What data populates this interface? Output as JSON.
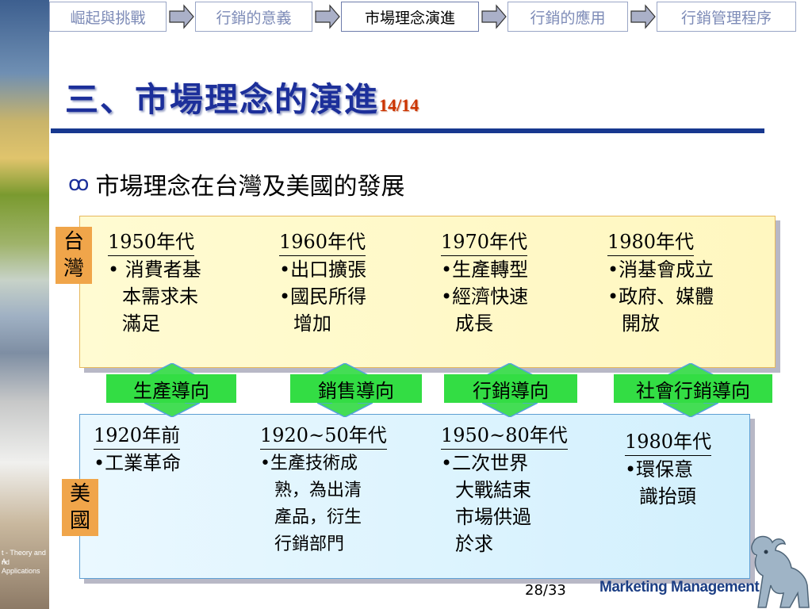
{
  "side": {
    "caption_line1": "t - Theory and A",
    "caption_line2": "nd Applications"
  },
  "nav": {
    "tabs": [
      {
        "label": "崛起與挑戰",
        "active": false
      },
      {
        "label": "行銷的意義",
        "active": false
      },
      {
        "label": "市場理念演進",
        "active": true
      },
      {
        "label": "行銷的應用",
        "active": false
      },
      {
        "label": "行銷管理程序",
        "active": false
      }
    ]
  },
  "title": {
    "text": "三、市場理念的演進",
    "page": "14/14"
  },
  "bullet": {
    "text": "市場理念在台灣及美國的發展"
  },
  "taiwan": {
    "tag": [
      "台",
      "灣"
    ],
    "columns": [
      {
        "era": "1950年代",
        "lines": [
          "• 消費者基",
          "本需求未",
          "滿足"
        ]
      },
      {
        "era": "1960年代",
        "lines": [
          "•出口擴張",
          "•國民所得",
          "增加"
        ]
      },
      {
        "era": "1970年代",
        "lines": [
          "•生產轉型",
          "•經濟快速",
          "成長"
        ]
      },
      {
        "era": "1980年代",
        "lines": [
          "•消基會成立",
          "•政府、媒體",
          "開放"
        ]
      }
    ]
  },
  "orientations": [
    "生產導向",
    "銷售導向",
    "行銷導向",
    "社會行銷導向"
  ],
  "usa": {
    "tag": [
      "美",
      "國"
    ],
    "columns": [
      {
        "era": "1920年前",
        "lines": [
          "•工業革命"
        ]
      },
      {
        "era": "1920~50年代",
        "lines": [
          "•生產技術成",
          "熟，為出清",
          "產品，衍生",
          "行銷部門"
        ]
      },
      {
        "era": "1950~80年代",
        "lines": [
          "•二次世界",
          "大戰結束",
          "市場供過",
          "於求"
        ]
      },
      {
        "era": "1980年代",
        "lines": [
          "•環保意",
          "識抬頭"
        ]
      }
    ]
  },
  "footer": {
    "page": "28",
    "total": "/33",
    "brand": "Marketing Management"
  },
  "colors": {
    "title": "#1c2f9a",
    "rule": "#17388f",
    "tag": "#f0a54a",
    "band": "#33dd44",
    "page_ref": "#cc3300"
  }
}
